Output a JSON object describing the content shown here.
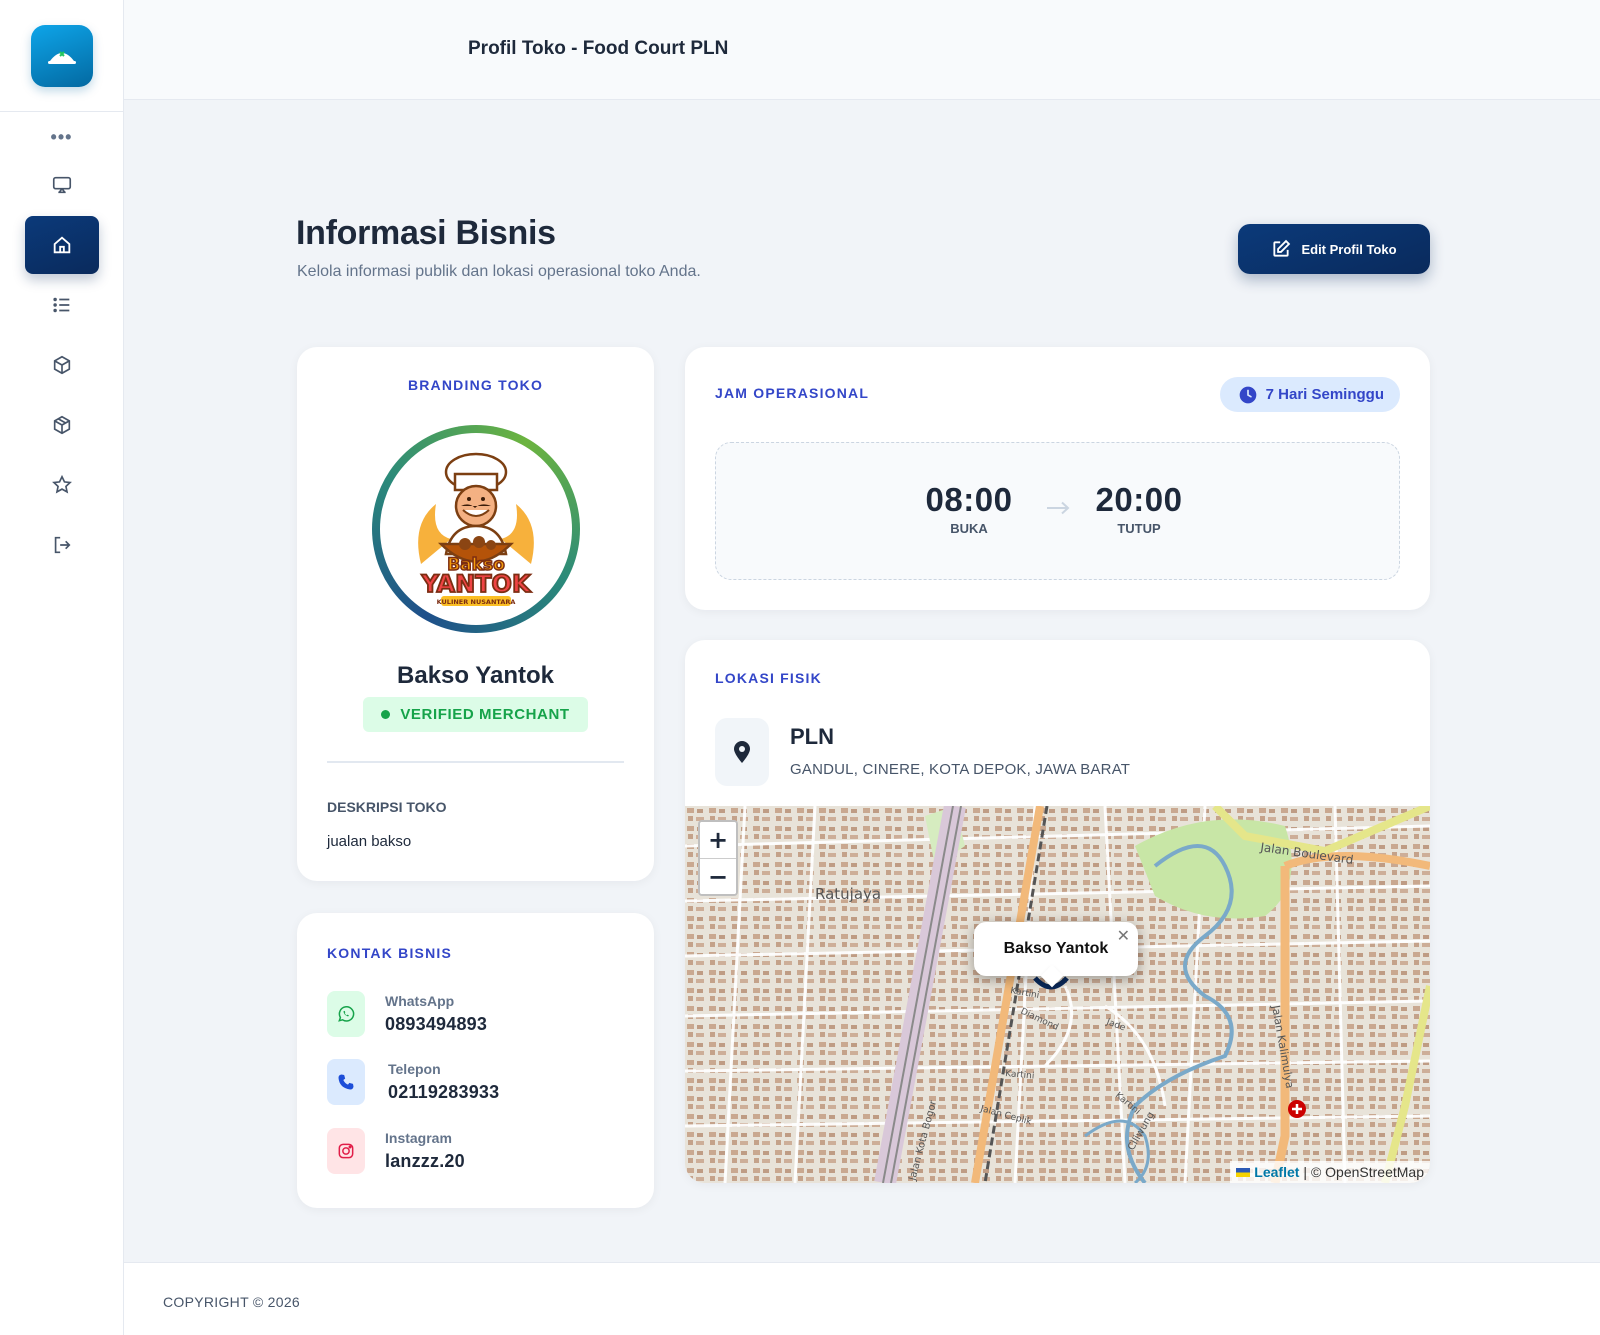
{
  "header": {
    "title": "Profil Toko - Food Court PLN"
  },
  "sidebar": {
    "more_label": "•••",
    "items": [
      {
        "icon": "monitor-icon"
      },
      {
        "icon": "home-icon",
        "active": true
      },
      {
        "icon": "list-icon"
      },
      {
        "icon": "box-icon"
      },
      {
        "icon": "box-icon"
      },
      {
        "icon": "star-icon"
      },
      {
        "icon": "logout-icon"
      }
    ]
  },
  "page": {
    "title": "Informasi Bisnis",
    "subtitle": "Kelola informasi publik dan lokasi operasional toko Anda.",
    "edit_button": "Edit Profil Toko"
  },
  "branding": {
    "label": "BRANDING TOKO",
    "logo_text_top": "Bakso",
    "logo_text_main": "YANTOK",
    "logo_text_sub": "KULINER NUSANTARA",
    "shop_name": "Bakso Yantok",
    "verified_label": "VERIFIED MERCHANT",
    "description_label": "DESKRIPSI TOKO",
    "description": "jualan bakso"
  },
  "contact": {
    "label": "KONTAK BISNIS",
    "items": [
      {
        "label": "WhatsApp",
        "value": "0893494893",
        "icon": "whatsapp-icon",
        "color": "#16a34a"
      },
      {
        "label": "Telepon",
        "value": "02119283933",
        "icon": "phone-icon",
        "color": "#2563eb"
      },
      {
        "label": "Instagram",
        "value": "lanzzz.20",
        "icon": "instagram-icon",
        "color": "#e11d48"
      }
    ]
  },
  "hours": {
    "label": "JAM OPERASIONAL",
    "badge": "7 Hari Seminggu",
    "open_time": "08:00",
    "open_label": "BUKA",
    "close_time": "20:00",
    "close_label": "TUTUP"
  },
  "location": {
    "label": "LOKASI FISIK",
    "name": "PLN",
    "address": "GANDUL, CINERE, KOTA DEPOK, JAWA BARAT",
    "map": {
      "popup": "Bakso Yantok",
      "zoom_in": "+",
      "zoom_out": "−",
      "attribution_link": "Leaflet",
      "attribution_text": "| © OpenStreetMap",
      "labels": [
        "Ratujaya",
        "Jalan Boulevard",
        "Jalan Kalimulya",
        "Kartini",
        "Diamond",
        "Jade",
        "Jalan Ceplik",
        "Ciliwung",
        "Jalan Kota Bogor",
        "Kartini",
        "Kartini"
      ]
    }
  },
  "footer": {
    "copyright": "COPYRIGHT © 2026"
  },
  "colors": {
    "primary": "#0a2a5c",
    "accent": "#3346c8",
    "success": "#16a34a"
  }
}
